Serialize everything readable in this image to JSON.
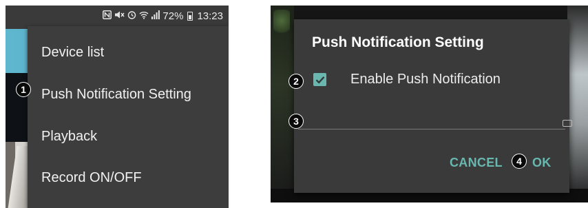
{
  "left_screen": {
    "status_bar": {
      "icons": [
        "nfc-icon",
        "mute-icon",
        "alarm-icon",
        "wifi-icon",
        "signal-icon"
      ],
      "battery_text": "72%",
      "time": "13:23"
    },
    "menu": {
      "items": [
        {
          "label": "Device list"
        },
        {
          "label": "Push Notification Setting",
          "callout": "1"
        },
        {
          "label": "Playback"
        },
        {
          "label": "Record ON/OFF"
        }
      ]
    }
  },
  "right_screen": {
    "dialog": {
      "title": "Push Notification Setting",
      "checkbox": {
        "label": "Enable Push Notification",
        "checked": true,
        "callout": "2"
      },
      "text_field": {
        "value": "",
        "callout": "3"
      },
      "buttons": {
        "cancel": "CANCEL",
        "ok": "OK",
        "ok_callout": "4"
      }
    }
  },
  "colors": {
    "accent": "#69b8b0",
    "menu_bg": "#3d3d3d",
    "dialog_bg": "#3a3a3a"
  }
}
